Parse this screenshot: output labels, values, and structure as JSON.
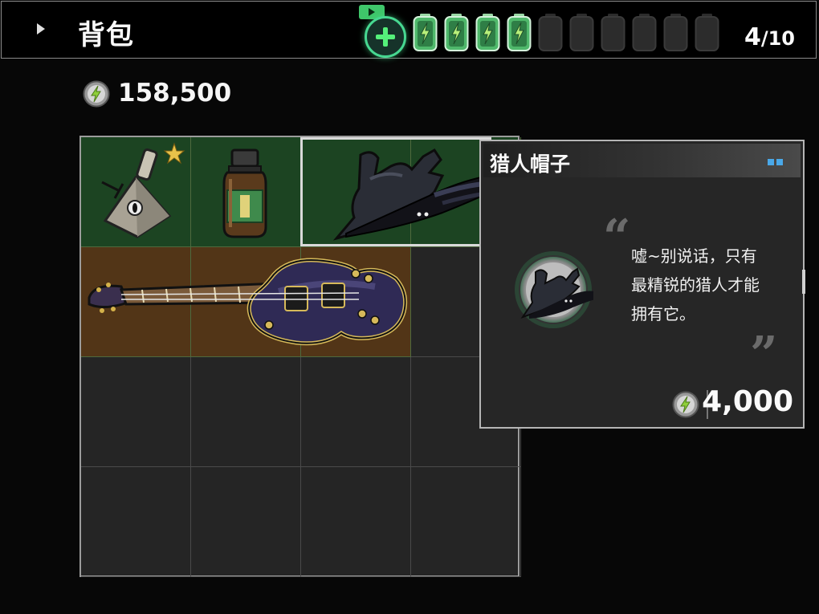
{
  "header": {
    "title": "背包",
    "energy_current": "4",
    "energy_max": "/10",
    "energy_filled": 4,
    "energy_total": 10,
    "colors": {
      "battery_full": "#4fb86b",
      "battery_empty": "#2c2c2c",
      "plus": "#55f07a"
    }
  },
  "currency": {
    "amount": "158,500",
    "icon": "bolt-coin-icon"
  },
  "grid": {
    "columns": 4,
    "rows": 4,
    "items": [
      {
        "name": "bell-item",
        "icon": "pyramid-bell-icon"
      },
      {
        "name": "potion-bottle-item",
        "icon": "bottle-icon"
      },
      {
        "name": "hunter-hat-item",
        "icon": "black-hat-icon",
        "selected": true
      },
      {
        "name": "guitar-item",
        "icon": "electric-guitar-icon"
      }
    ]
  },
  "tooltip": {
    "title": "猎人帽子",
    "description_lines": [
      "嘘~别说话，只有",
      "最精锐的猎人才能",
      "拥有它。"
    ],
    "price": "4,000",
    "rarity_color": "#4aa8e8"
  }
}
